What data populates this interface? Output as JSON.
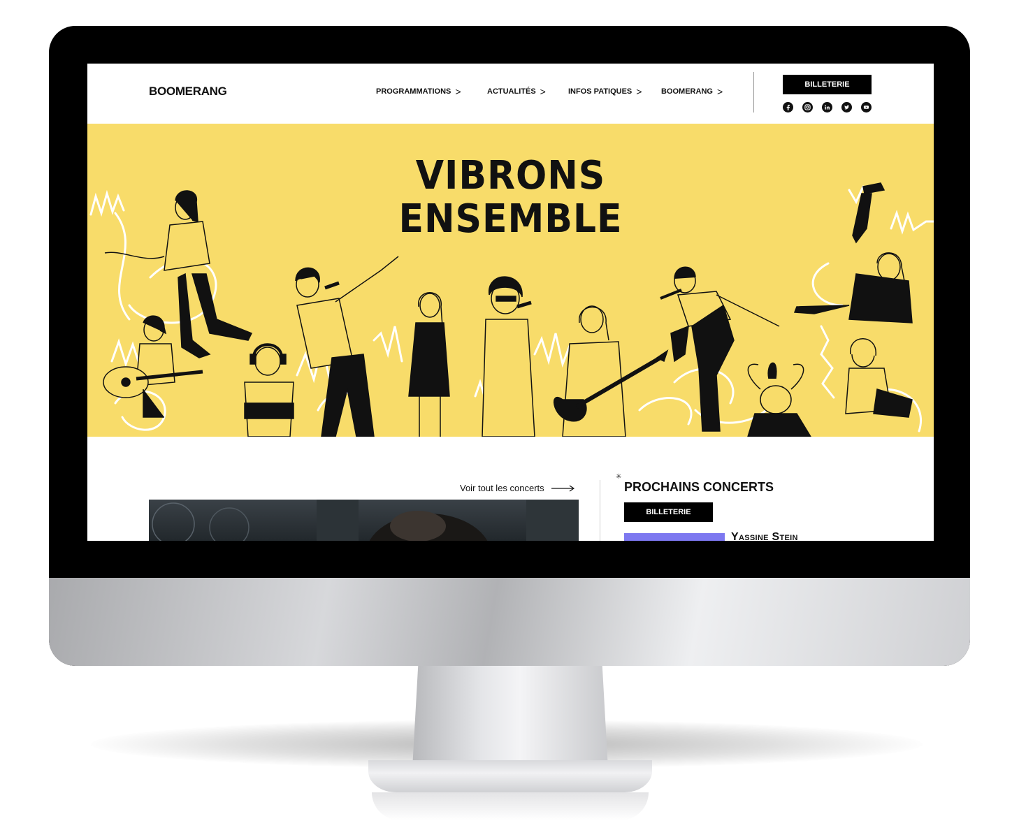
{
  "header": {
    "logo": "BOOMERANG",
    "nav": [
      {
        "label": "PROGRAMMATIONS"
      },
      {
        "label": "ACTUALITÉS"
      },
      {
        "label": "INFOS PATIQUES"
      },
      {
        "label": "BOOMERANG"
      }
    ],
    "ticket_button": "BILLETERIE",
    "socials": [
      "facebook-icon",
      "instagram-icon",
      "linkedin-icon",
      "twitter-icon",
      "youtube-icon"
    ]
  },
  "hero": {
    "title_line1": "VIBRONS",
    "title_line2": "ENSEMBLE",
    "background_color": "#f8dc6a"
  },
  "concerts": {
    "see_all": "Voir tout les concerts",
    "next_title": "PROCHAINS CONCERTS",
    "ticket_button": "BILLETERIE",
    "first_event": "Yassine Stein"
  }
}
